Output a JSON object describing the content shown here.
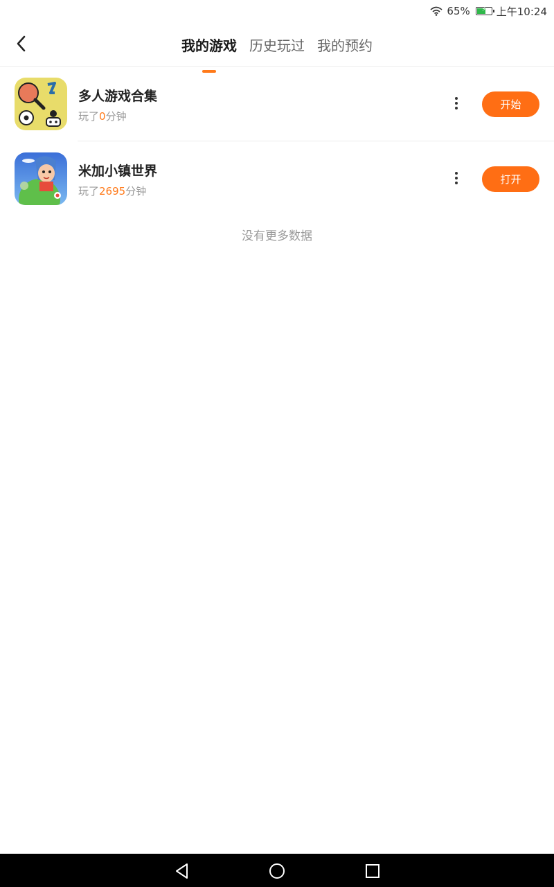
{
  "status_bar": {
    "battery_percent": "65%",
    "battery_level": 0.65,
    "time": "上午10:24",
    "icons": [
      "wifi-icon",
      "battery-icon"
    ]
  },
  "header": {
    "back_icon": "back-arrow-icon",
    "tabs": [
      {
        "label": "我的游戏",
        "active": true
      },
      {
        "label": "历史玩过",
        "active": false
      },
      {
        "label": "我的预约",
        "active": false
      }
    ]
  },
  "games": [
    {
      "name": "多人游戏合集",
      "played_prefix": "玩了",
      "played_value": "0",
      "played_suffix": "分钟",
      "action_label": "开始",
      "icon": "multiplayer-game-icon"
    },
    {
      "name": "米加小镇世界",
      "played_prefix": "玩了",
      "played_value": "2695",
      "played_suffix": "分钟",
      "action_label": "打开",
      "icon": "miga-town-icon"
    }
  ],
  "empty_note": "没有更多数据",
  "colors": {
    "accent": "#ff6e14",
    "highlight_text": "#ff7a1a",
    "muted_text": "#999999"
  },
  "nav_bar": {
    "icons": [
      "back-triangle-icon",
      "home-circle-icon",
      "recents-square-icon"
    ]
  }
}
